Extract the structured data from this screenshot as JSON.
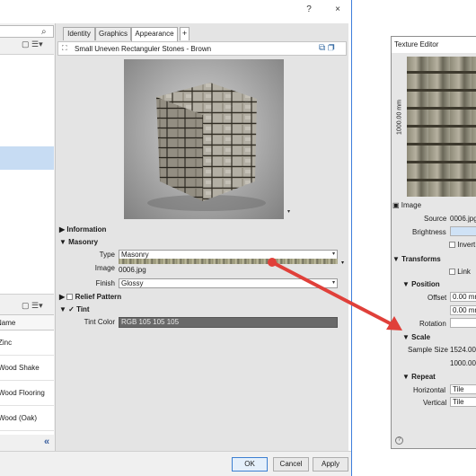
{
  "dialog": {
    "help_glyph": "?",
    "close_glyph": "×"
  },
  "left_panel": {
    "search_icon": "magnifier",
    "toolbar_icons": "▢ ☰▾",
    "materials_header": "Name",
    "materials": [
      "Zinc",
      "Wood Shake",
      "Wood Flooring",
      "Wood (Oak)"
    ],
    "collapse_glyph": "«"
  },
  "editor": {
    "tabs": [
      "Identity",
      "Graphics",
      "Appearance"
    ],
    "active_tab": "Appearance",
    "add_tab_glyph": "+",
    "asset_name": "Small Uneven Rectanguler Stones - Brown",
    "preview_dropdown_glyph": "▾",
    "sections": {
      "information": "Information",
      "masonry": "Masonry",
      "relief_pattern": "Relief Pattern",
      "tint": "Tint"
    },
    "masonry": {
      "type_label": "Type",
      "type_value": "Masonry",
      "image_label": "Image",
      "image_file": "0006.jpg",
      "finish_label": "Finish",
      "finish_value": "Glossy"
    },
    "tint": {
      "color_label": "Tint Color",
      "color_value": "RGB 105 105 105",
      "tint_rgb": "#696969"
    }
  },
  "footer": {
    "ok": "OK",
    "cancel": "Cancel",
    "apply": "Apply"
  },
  "texture_editor": {
    "title": "Texture Editor",
    "ruler_label": "1000.00 mm",
    "image_section": "Image",
    "source_label": "Source",
    "source_value": "0006.jpg",
    "brightness_label": "Brightness",
    "invert_label": "Invert",
    "transforms_section": "Transforms",
    "link_label": "Link",
    "position_section": "Position",
    "offset_label": "Offset",
    "offset_x": "0.00 mm",
    "offset_y": "0.00 mm",
    "rotation_label": "Rotation",
    "scale_section": "Scale",
    "sample_size_label": "Sample Size",
    "sample_width": "1524.00",
    "sample_height": "1000.00",
    "repeat_section": "Repeat",
    "horizontal_label": "Horizontal",
    "horizontal_value": "Tile",
    "vertical_label": "Vertical",
    "vertical_value": "Tile",
    "help_glyph": "?"
  },
  "annotation": {
    "arrow_color": "#e0403a",
    "highlight_color": "#e7e45a"
  }
}
